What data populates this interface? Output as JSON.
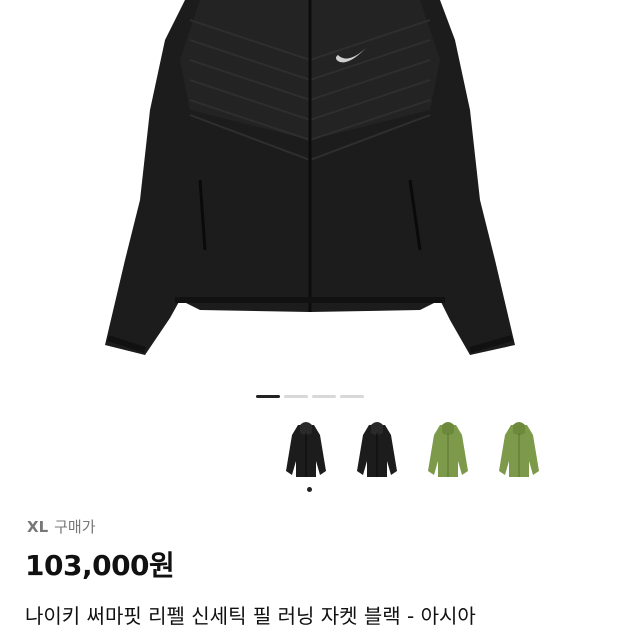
{
  "product": {
    "images_count": 4,
    "current_image": 1,
    "thumbnails": [
      {
        "icon": "jacket-black-icon",
        "color": "#1c1c1c"
      },
      {
        "icon": "jacket-black-icon",
        "color": "#1c1c1c"
      },
      {
        "icon": "jacket-green-icon",
        "color": "#7d9a4a"
      },
      {
        "icon": "jacket-green-icon",
        "color": "#7d9a4a"
      }
    ],
    "size": "XL",
    "purchase_type": "구매가",
    "price": "103,000원",
    "title": "나이키 써마핏 리펠 신세틱 필 러닝 자켓 블랙 - 아시아"
  },
  "colors": {
    "jacket_black": "#1c1c1c",
    "jacket_green": "#7d9a4a",
    "pager_active": "#222222",
    "pager_inactive": "#d8d8d8"
  }
}
